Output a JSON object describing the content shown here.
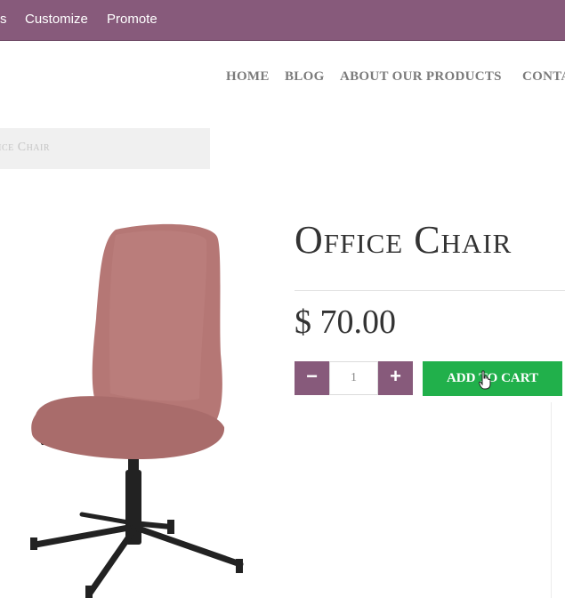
{
  "topbar": {
    "items": [
      "s",
      "Customize",
      "Promote"
    ]
  },
  "nav": {
    "items": [
      "HOME",
      "BLOG",
      "ABOUT OUR PRODUCTS",
      "CONTA"
    ]
  },
  "breadcrumb": {
    "label": "ffice Chair"
  },
  "product": {
    "title": "Office Chair",
    "price": "$ 70.00",
    "quantity": "1",
    "minus_label": "−",
    "plus_label": "+",
    "add_to_cart_label": "ADD TO CART"
  },
  "colors": {
    "topbar": "#875a7b",
    "add_to_cart": "#21b04b",
    "chair_upholstery": "#b57775",
    "chair_base": "#222222"
  },
  "icons": {
    "cursor": "hand-pointer-icon"
  }
}
